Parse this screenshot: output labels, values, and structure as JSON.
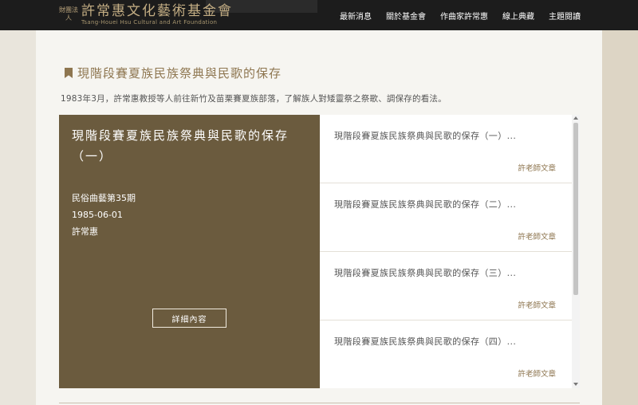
{
  "header": {
    "logo_prefix": "財團法人",
    "logo_title": "許常惠文化藝術基金會",
    "logo_subtitle": "Tsang-Houei Hsu Cultural and Art Foundation",
    "nav": [
      "最新消息",
      "關於基金會",
      "作曲家許常惠",
      "線上典藏",
      "主題閱讀"
    ]
  },
  "page": {
    "title": "現階段賽夏族民族祭典與民歌的保存",
    "intro": "1983年3月，許常惠教授等人前往新竹及苗栗賽夏族部落，了解族人對矮靈祭之祭歌、調保存的看法。"
  },
  "featured": {
    "title": "現階段賽夏族民族祭典與民歌的保存（一）",
    "publication": "民俗曲藝第35期",
    "date": "1985-06-01",
    "author": "許常惠",
    "button_label": "詳細內容"
  },
  "articles": [
    {
      "title": "現階段賽夏族民族祭典與民歌的保存（一）...",
      "tag": "許老師文章"
    },
    {
      "title": "現階段賽夏族民族祭典與民歌的保存（二）...",
      "tag": "許老師文章"
    },
    {
      "title": "現階段賽夏族民族祭典與民歌的保存（三）...",
      "tag": "許老師文章"
    },
    {
      "title": "現階段賽夏族民族祭典與民歌的保存（四）...",
      "tag": "許老師文章"
    }
  ],
  "colors": {
    "accent": "#8e7650",
    "feature_bg": "#6b5b3e",
    "header_bg": "#1c1c1c"
  }
}
